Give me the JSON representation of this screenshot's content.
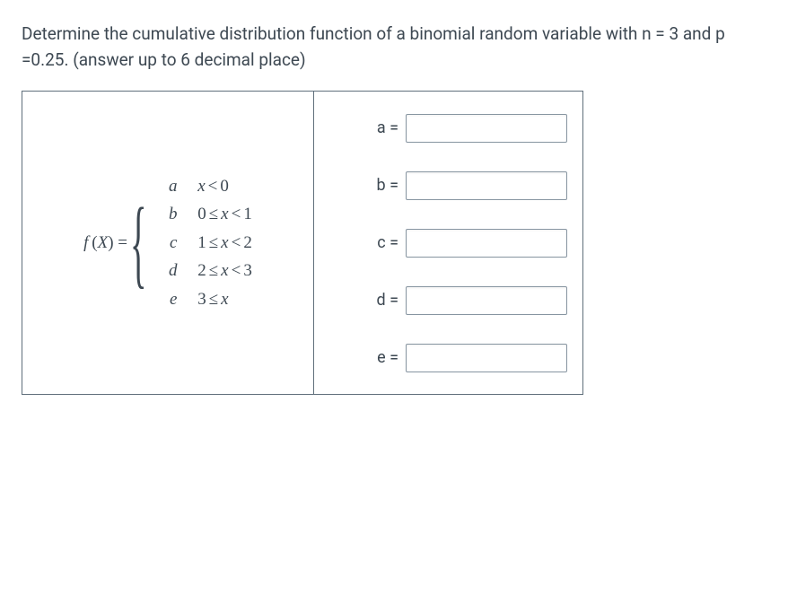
{
  "question": "Determine the cumulative distribution function of a binomial random variable with n = 3 and p =0.25. (answer up to 6 decimal place)",
  "function": {
    "prefix_f": "f",
    "prefix_X": "X",
    "cases": [
      {
        "letter": "a",
        "cond_html": "x < 0"
      },
      {
        "letter": "b",
        "cond_html": "0 ≤ x < 1"
      },
      {
        "letter": "c",
        "cond_html": "1 ≤ x < 2"
      },
      {
        "letter": "d",
        "cond_html": "2 ≤ x < 3"
      },
      {
        "letter": "e",
        "cond_html": "3 ≤ x"
      }
    ]
  },
  "answers": [
    {
      "label": "a =",
      "value": ""
    },
    {
      "label": "b =",
      "value": ""
    },
    {
      "label": "c =",
      "value": ""
    },
    {
      "label": "d =",
      "value": ""
    },
    {
      "label": "e =",
      "value": ""
    }
  ]
}
